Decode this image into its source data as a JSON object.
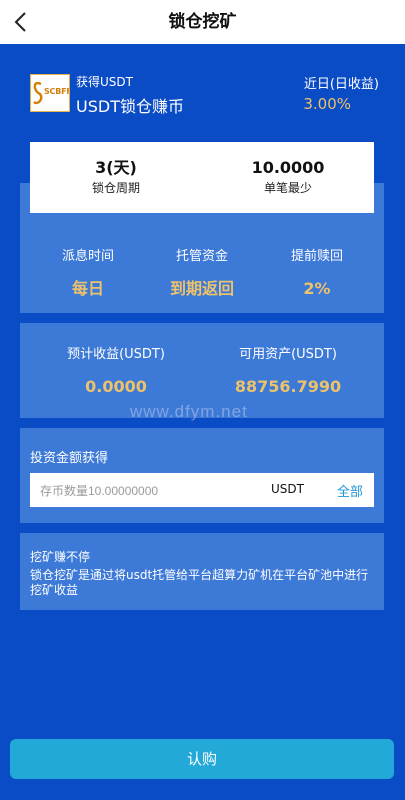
{
  "header": {
    "title": "锁仓挖矿",
    "back_icon": "chevron-left-icon"
  },
  "product": {
    "logo_text": "SCBFF",
    "subtitle": "获得USDT",
    "name": "USDT锁仓赚币",
    "yield_label": "近日(日收益)",
    "yield_value": "3.00%"
  },
  "summary": {
    "period_value": "3(天)",
    "period_label": "锁仓周期",
    "min_value": "10.0000",
    "min_label": "单笔最少"
  },
  "terms": [
    {
      "label": "派息时间",
      "value": "每日"
    },
    {
      "label": "托管资金",
      "value": "到期返回"
    },
    {
      "label": "提前赎回",
      "value": "2%"
    }
  ],
  "estimate": {
    "income_label": "预计收益(USDT)",
    "income_value": "0.0000",
    "available_label": "可用资产(USDT)",
    "available_value": "88756.7990"
  },
  "invest": {
    "title": "投资金额获得",
    "placeholder": "存币数量10.00000000",
    "unit": "USDT",
    "all_label": "全部"
  },
  "tip": {
    "title": "挖矿赚不停",
    "text": "锁仓挖矿是通过将usdt托管给平台超算力矿机在平台矿池中进行挖矿收益"
  },
  "watermark": "www.dfym.net",
  "submit_label": "认购",
  "colors": {
    "background": "#0a4bc6",
    "panel": "#3d79d7",
    "accent": "#ecc26a",
    "button": "#22a9d8"
  }
}
